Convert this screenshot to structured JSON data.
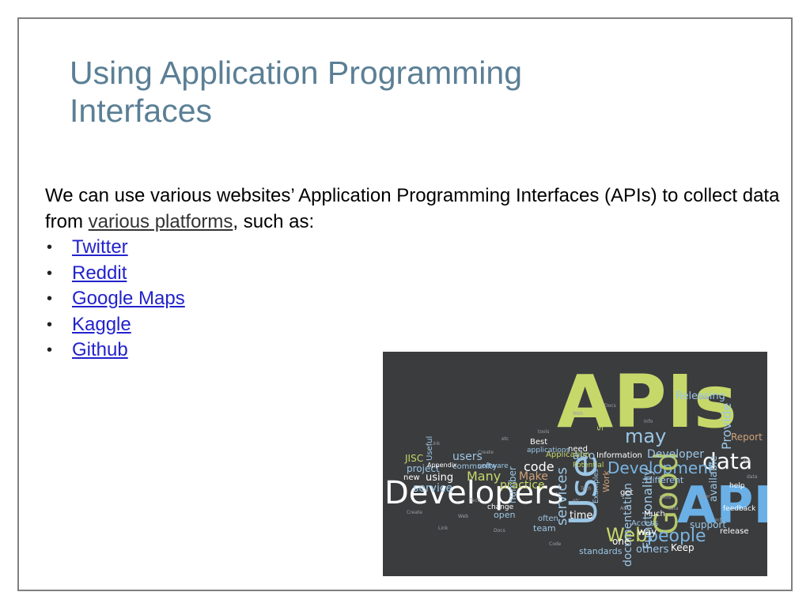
{
  "slide": {
    "title": "Using Application Programming Interfaces",
    "intro_before_link": "We can use various websites’ Application Programming Interfaces (APIs) to collect data from ",
    "intro_link": "various platforms",
    "intro_after_link": ", such as:",
    "bullet_glyph": "•",
    "apis": [
      {
        "label": "Twitter"
      },
      {
        "label": "Reddit"
      },
      {
        "label": "Google Maps"
      },
      {
        "label": "Kaggle"
      },
      {
        "label": "Github"
      }
    ]
  },
  "wordcloud": {
    "background_color": "#3b3c3e",
    "words": [
      "APIs",
      "Developers",
      "API",
      "data",
      "Use",
      "Development",
      "Good",
      "Web",
      "people",
      "may",
      "Releasing",
      "Provide",
      "Report",
      "services",
      "documentation",
      "Many",
      "users",
      "Developer",
      "practice",
      "code",
      "project",
      "service",
      "using",
      "JISC",
      "Make",
      "Best",
      "need",
      "also",
      "Information",
      "Functionality",
      "available",
      "Different",
      "time",
      "standards",
      "others",
      "Keep",
      "support",
      "one",
      "number",
      "Application",
      "applications",
      "community",
      "software",
      "Work",
      "Examples",
      "Useful",
      "Survey",
      "open",
      "Much",
      "way",
      "Access",
      "Potential",
      "get",
      "help",
      "release",
      "feedback",
      "team",
      "often",
      "new",
      "change",
      "Appendix"
    ]
  }
}
